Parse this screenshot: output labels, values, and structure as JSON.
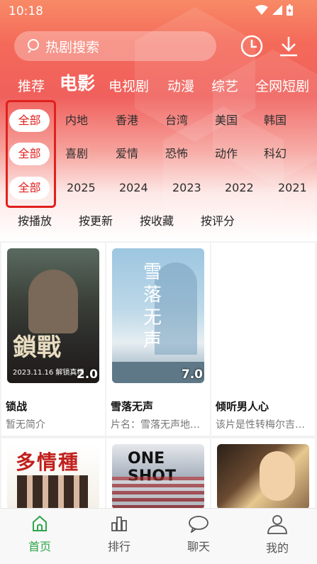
{
  "status_bar": {
    "time": "10:18"
  },
  "search": {
    "placeholder": "热剧搜索"
  },
  "tabs": [
    {
      "label": "推荐"
    },
    {
      "label": "电影",
      "active": true
    },
    {
      "label": "电视剧"
    },
    {
      "label": "动漫"
    },
    {
      "label": "综艺"
    },
    {
      "label": "全网短剧"
    }
  ],
  "filters": {
    "all_label": "全部",
    "region": [
      "内地",
      "香港",
      "台湾",
      "美国",
      "韩国"
    ],
    "genre": [
      "喜剧",
      "爱情",
      "恐怖",
      "动作",
      "科幻"
    ],
    "year": [
      "2025",
      "2024",
      "2023",
      "2022",
      "2021"
    ]
  },
  "sort_options": [
    "按播放",
    "按更新",
    "按收藏",
    "按评分"
  ],
  "movies": [
    {
      "title": "锁战",
      "desc": "暂无简介",
      "score": "2.0",
      "poster_text": "鎖戰",
      "poster_sub": "2023.11.16 解锁真相"
    },
    {
      "title": "雪落无声",
      "desc": "片名：雪落无声地…",
      "score": "7.0",
      "poster_text": "雪落无声"
    },
    {
      "title": "倾听男人心",
      "desc": "该片是性转梅尔吉…",
      "score": ""
    }
  ],
  "movies_row2": [
    {
      "poster_text": "多情種"
    },
    {
      "poster_text": "ONE SHOT"
    },
    {
      "poster_text": ""
    }
  ],
  "nav": [
    {
      "label": "首页",
      "icon": "home-icon",
      "active": true
    },
    {
      "label": "排行",
      "icon": "rank-icon"
    },
    {
      "label": "聊天",
      "icon": "chat-icon"
    },
    {
      "label": "我的",
      "icon": "profile-icon"
    }
  ],
  "colors": {
    "accent": "#e0211d",
    "nav_active": "#2ea54a",
    "hero_top": "#f46a5a"
  }
}
